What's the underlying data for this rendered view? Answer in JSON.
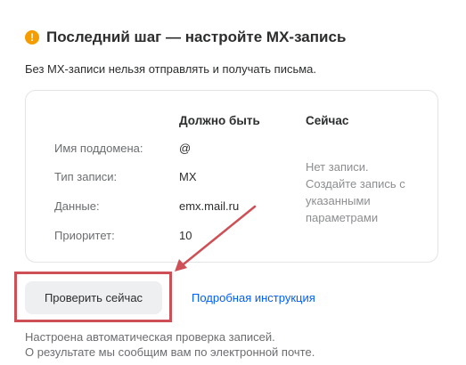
{
  "heading": {
    "icon": "exclamation-icon",
    "icon_glyph": "!",
    "title": "Последний шаг — настройте MX-запись"
  },
  "subtitle": "Без MX-записи нельзя отправлять и получать письма.",
  "card": {
    "column_expected": "Должно быть",
    "column_now": "Сейчас",
    "rows": [
      {
        "label": "Имя поддомена:",
        "value": "@"
      },
      {
        "label": "Тип записи:",
        "value": "MX"
      },
      {
        "label": "Данные:",
        "value": "emx.mail.ru"
      },
      {
        "label": "Приоритет:",
        "value": "10"
      }
    ],
    "now_status": "Нет записи. Создайте запись с указанными параметрами"
  },
  "actions": {
    "check_button": "Проверить сейчас",
    "guide_link": "Подробная инструкция"
  },
  "footer": {
    "line1": "Настроена автоматическая проверка записей.",
    "line2": "О результате мы сообщим вам по электронной почте."
  },
  "colors": {
    "accent_warning": "#f59c00",
    "link": "#005ff9",
    "annotation": "#cf4f56"
  }
}
